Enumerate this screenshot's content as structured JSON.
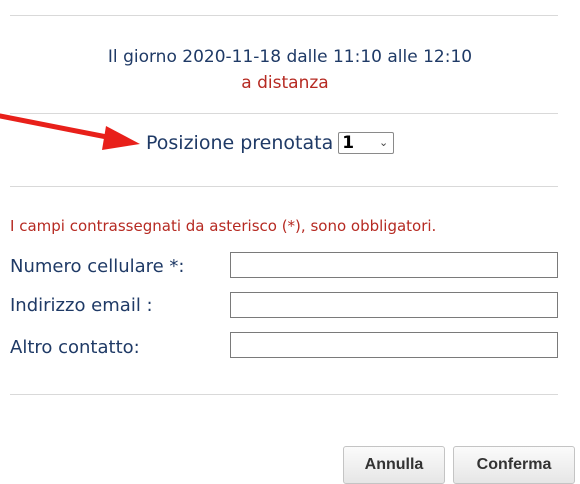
{
  "appointment": {
    "date_line": "Il giorno 2020-11-18 dalle 11:10 alle 12:10",
    "mode": "a distanza"
  },
  "position": {
    "label": "Posizione prenotata",
    "selected": "1"
  },
  "form": {
    "required_note": "I campi contrassegnati da asterisco (*), sono obbligatori.",
    "phone_label": "Numero cellulare *:",
    "phone_value": "",
    "email_label": "Indirizzo email :",
    "email_value": "",
    "other_label": "Altro contatto:",
    "other_value": ""
  },
  "buttons": {
    "cancel": "Annulla",
    "confirm": "Conferma"
  },
  "colors": {
    "text_blue": "#1f3a66",
    "text_red": "#b62a22",
    "arrow_red": "#e8201a"
  }
}
